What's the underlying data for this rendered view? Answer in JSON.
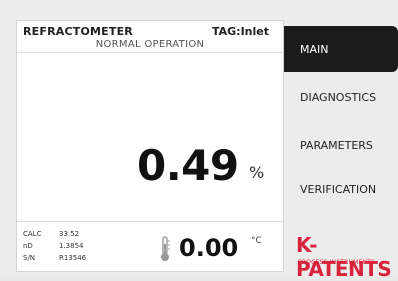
{
  "header": {
    "device_name": "REFRACTOMETER",
    "tag": "TAG:Inlet",
    "mode": "NORMAL OPERATION"
  },
  "measurement": {
    "value": "0.49",
    "unit": "%"
  },
  "info": [
    {
      "label": "CALC",
      "value": "33.52"
    },
    {
      "label": "nD",
      "value": "1.3854"
    },
    {
      "label": "S/N",
      "value": "R13546"
    }
  ],
  "temperature": {
    "value": "0.00",
    "unit": "°C"
  },
  "nav": {
    "items": [
      {
        "label": "MAIN"
      },
      {
        "label": "DIAGNOSTICS"
      },
      {
        "label": "PARAMETERS"
      },
      {
        "label": "VERIFICATION"
      }
    ],
    "active_index": 0
  },
  "logo": {
    "main": "K-PATENTS",
    "sub": "PROCESS INSTRUMENTS"
  },
  "colors": {
    "brand_red": "#d9233a",
    "nav_active_bg": "#1b1b1b"
  }
}
